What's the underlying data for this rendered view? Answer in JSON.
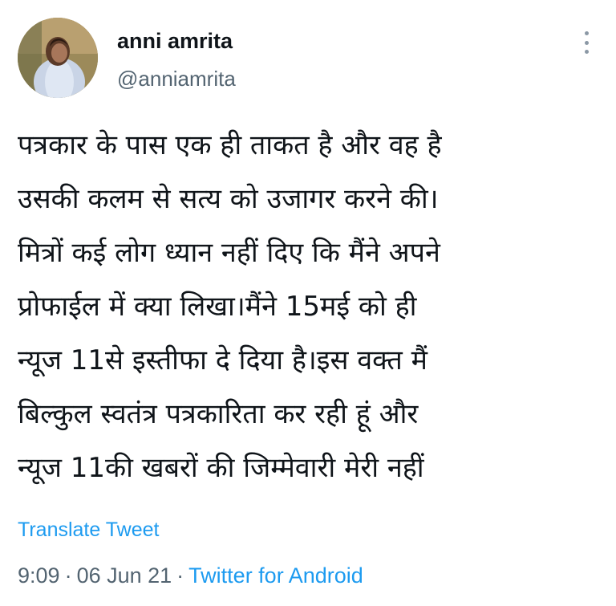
{
  "tweet": {
    "author": {
      "display_name": "anni amrita",
      "handle": "@anniamrita",
      "avatar_icon": "profile-photo"
    },
    "more_icon": "vertical-ellipsis-icon",
    "text_lines": [
      "पत्रकार के पास एक ही ताकत है और वह है",
      "उसकी कलम से सत्य को उजागर करने की।",
      "मित्रों कई लोग ध्यान नहीं दिए कि मैंने अपने",
      "प्रोफाईल में क्या लिखा।मैंने 15मई को ही",
      "न्यूज 11से इस्तीफा दे दिया है।इस वक्त मैं",
      "बिल्कुल स्वतंत्र पत्रकारिता कर रही हूं और",
      "न्यूज 11की खबरों की जिम्मेवारी मेरी नहीं"
    ],
    "translate_label": "Translate Tweet",
    "time": "9:09",
    "separator": "·",
    "date": "06 Jun 21",
    "source": "Twitter for Android",
    "colors": {
      "link": "#1d9bf0",
      "secondary_text": "#536471",
      "primary_text": "#0f1419"
    }
  }
}
